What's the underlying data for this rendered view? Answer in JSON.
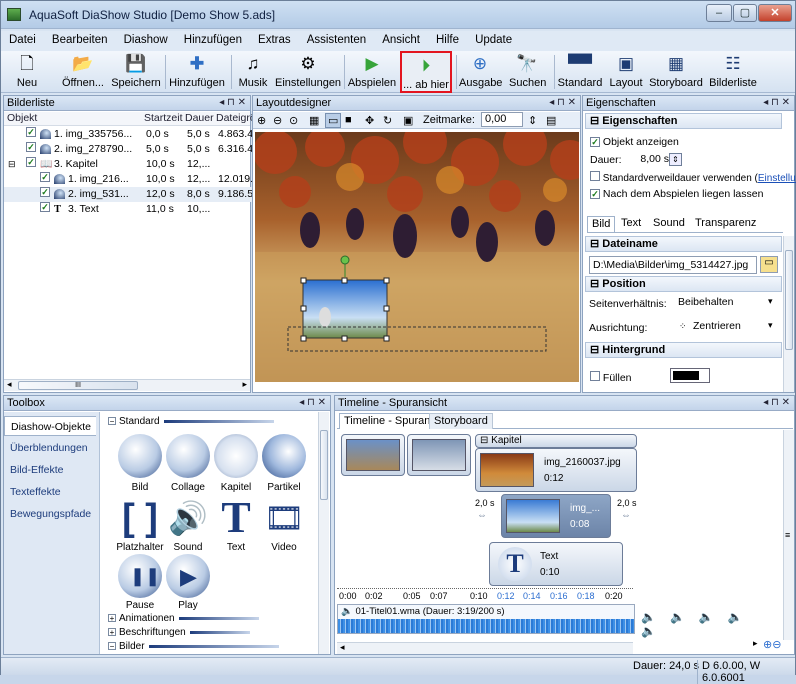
{
  "window": {
    "title": "AquaSoft DiaShow Studio [Demo Show 5.ads]",
    "min": "–",
    "max": "▢",
    "close": "✕"
  },
  "menu": [
    "Datei",
    "Bearbeiten",
    "Diashow",
    "Hinzufügen",
    "Extras",
    "Assistenten",
    "Ansicht",
    "Hilfe",
    "Update"
  ],
  "toolbar": {
    "neu": "Neu",
    "oeffnen": "Öffnen...",
    "speichern": "Speichern",
    "hinzufuegen": "Hinzufügen",
    "musik": "Musik",
    "einstellungen": "Einstellungen",
    "abspielen": "Abspielen",
    "abhier": "... ab hier",
    "ausgabe": "Ausgabe",
    "suchen": "Suchen",
    "standard": "Standard",
    "layout": "Layout",
    "storyboard": "Storyboard",
    "bilderliste": "Bilderliste"
  },
  "bilderliste": {
    "title": "Bilderliste",
    "columns": {
      "objekt": "Objekt",
      "startzeit": "Startzeit",
      "dauer": "Dauer",
      "dateigr": "Dateigrö"
    },
    "rows": [
      {
        "name": "1. img_335756...",
        "start": "0,0 s",
        "dauer": "5,0 s",
        "size": "4.863.4"
      },
      {
        "name": "2. img_278790...",
        "start": "5,0 s",
        "dauer": "5,0 s",
        "size": "6.316.4"
      },
      {
        "name": "3. Kapitel",
        "start": "10,0 s",
        "dauer": "12,...",
        "size": ""
      },
      {
        "name": "1. img_216...",
        "start": "10,0 s",
        "dauer": "12,...",
        "size": "12.019."
      },
      {
        "name": "2. img_531...",
        "start": "12,0 s",
        "dauer": "8,0 s",
        "size": "9.186.5"
      },
      {
        "name": "3. Text",
        "start": "11,0 s",
        "dauer": "10,...",
        "size": ""
      }
    ],
    "scroll_grip": "III"
  },
  "layoutdesigner": {
    "title": "Layoutdesigner",
    "zeitmarke_label": "Zeitmarke:",
    "zeitmarke_value": "0,00"
  },
  "eigenschaften": {
    "title": "Eigenschaften",
    "section_main": "Eigenschaften",
    "objekt_anzeigen": "Objekt anzeigen",
    "dauer_label": "Dauer:",
    "dauer_value": "8,00 s",
    "standardverweil": "Standardverweildauer verwenden (",
    "einstellungen_link": "Einstellungen",
    "link_close": ")",
    "nach_abspielen": "Nach dem Abspielen liegen lassen",
    "tabs": [
      "Bild",
      "Text",
      "Sound",
      "Transparenz"
    ],
    "dateiname_section": "Dateiname",
    "dateiname_value": "D:\\Media\\Bilder\\img_5314427.jpg",
    "position_section": "Position",
    "seitenverhaeltnis_label": "Seitenverhältnis:",
    "seitenverhaeltnis_value": "Beibehalten",
    "ausrichtung_label": "Ausrichtung:",
    "ausrichtung_value": "Zentrieren",
    "hintergrund_section": "Hintergrund",
    "fuellen_label": "Füllen"
  },
  "toolbox": {
    "title": "Toolbox",
    "categories": [
      "Diashow-Objekte",
      "Überblendungen",
      "Bild-Effekte",
      "Texteffekte",
      "Bewegungspfade"
    ],
    "group_standard": "Standard",
    "items": [
      "Bild",
      "Collage",
      "Kapitel",
      "Partikel",
      "Platzhalter",
      "Sound",
      "Text",
      "Video",
      "Pause",
      "Play"
    ],
    "groups": [
      "Animationen",
      "Beschriftungen",
      "Bilder"
    ]
  },
  "timeline": {
    "title": "Timeline - Spuransicht",
    "tabs": [
      "Timeline - Spuransicht",
      "Storyboard"
    ],
    "kapitel": "Kapitel",
    "clip1_name": "img_2160037.jpg",
    "clip1_time": "0:12",
    "clip2_name": "img_...",
    "clip2_time": "0:08",
    "trans_left": "2,0 s",
    "trans_right": "2,0 s",
    "text_name": "Text",
    "text_time": "0:10",
    "ruler": [
      "0:00",
      "0:02",
      "0:05",
      "0:07",
      "0:10",
      "0:12",
      "0:14",
      "0:16",
      "0:18",
      "0:20"
    ],
    "audio": "01-Titel01.wma (Dauer: 3:19/200 s)"
  },
  "status": {
    "dauer": "Dauer: 24,0 s",
    "version": "D 6.0.00, W 6.0.6001"
  }
}
